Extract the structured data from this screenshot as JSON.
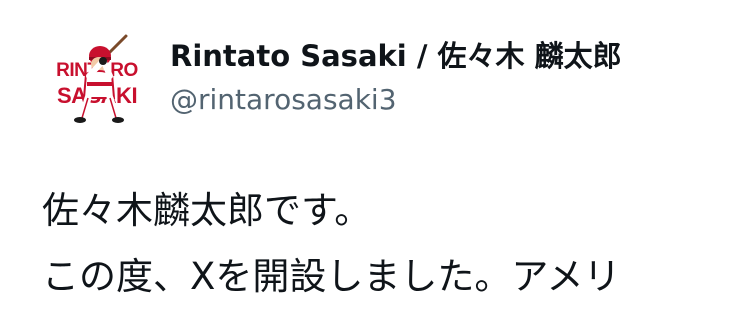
{
  "author": {
    "display_name": "Rintato Sasaki / 佐々木 麟太郎",
    "handle": "@rintarosasaki3",
    "avatar": {
      "icon": "player-illustration-icon",
      "text_top": "RINTARO",
      "text_bottom": "SASAKI",
      "accent_color": "#c8102e"
    }
  },
  "tweet": {
    "lines": [
      "佐々木麟太郎です。",
      "この度、Xを開設しました。アメリ"
    ]
  },
  "colors": {
    "text": "#0f1419",
    "secondary": "#536471",
    "background": "#ffffff"
  }
}
